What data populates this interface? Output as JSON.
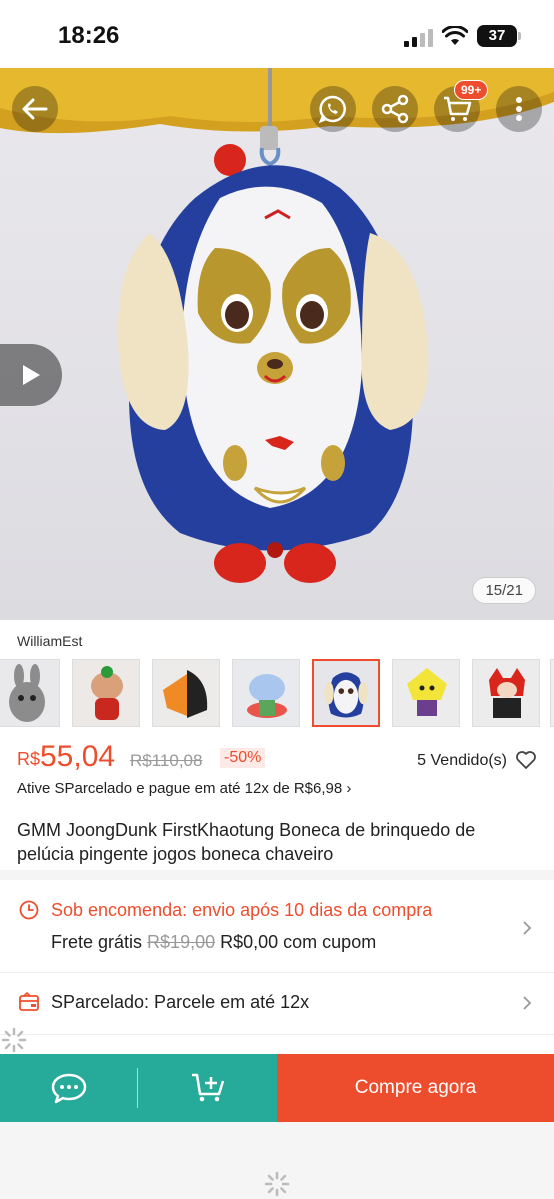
{
  "status": {
    "time": "18:26",
    "battery": "37"
  },
  "gallery": {
    "cart_badge": "99+",
    "page_indicator": "15/21"
  },
  "seller": {
    "name": "WilliamEst"
  },
  "price": {
    "currency": "R$",
    "current": "55,04",
    "original": "R$110,08",
    "discount": "-50%",
    "sold": "5 Vendido(s)"
  },
  "installment": {
    "text": "Ative SParcelado e pague em até 12x de R$6,98 ›"
  },
  "product": {
    "title": "GMM JoongDunk FirstKhaotung Boneca de brinquedo de pelúcia pingente jogos boneca chaveiro"
  },
  "shipping": {
    "title": "Sob encomenda: envio após 10 dias da compra",
    "free_label": "Frete grátis",
    "old_price": "R$19,00",
    "new_price": "R$0,00 com cupom"
  },
  "sparcelado": {
    "text": "SParcelado: Parcele em até 12x"
  },
  "bottom": {
    "buy_label": "Compre agora"
  },
  "icons": [
    "back-icon",
    "whatsapp-icon",
    "share-icon",
    "cart-icon",
    "more-icon",
    "play-icon",
    "heart-icon",
    "clock-icon",
    "card-icon",
    "chat-icon",
    "add-to-cart-icon",
    "chevron-right-icon",
    "spinner-icon"
  ],
  "colors": {
    "accent": "#ee4d2d",
    "teal": "#26aa99"
  }
}
